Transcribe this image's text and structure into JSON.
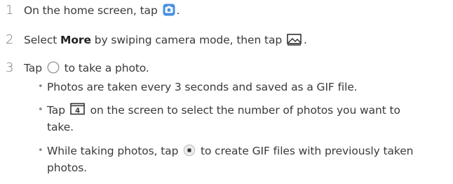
{
  "steps": [
    {
      "number": "1",
      "before": "On the home screen, tap ",
      "icon": "camera-app-icon",
      "after": "."
    },
    {
      "number": "2",
      "before": "Select ",
      "bold": "More",
      "middle": " by swiping camera mode, then tap ",
      "icon": "gif-mode-icon",
      "after": "."
    },
    {
      "number": "3",
      "before": "Tap ",
      "icon": "shutter-icon",
      "after": " to take a photo."
    }
  ],
  "bullets": [
    {
      "bullet": "•",
      "text": "Photos are taken every 3 seconds and saved as a GIF file."
    },
    {
      "bullet": "•",
      "before": "Tap ",
      "icon": "photo-count-icon",
      "icon_label": "4",
      "line1": " on the screen to select the number of photos you want to",
      "line2": "take."
    },
    {
      "bullet": "•",
      "before": "While taking photos, tap ",
      "icon": "create-gif-icon",
      "line1": " to create GIF files with previously taken",
      "line2": "photos."
    }
  ],
  "colors": {
    "camera_icon_blue": "#4a8fe0",
    "text": "#3a3a3a",
    "muted_number": "#7a7a7a"
  }
}
